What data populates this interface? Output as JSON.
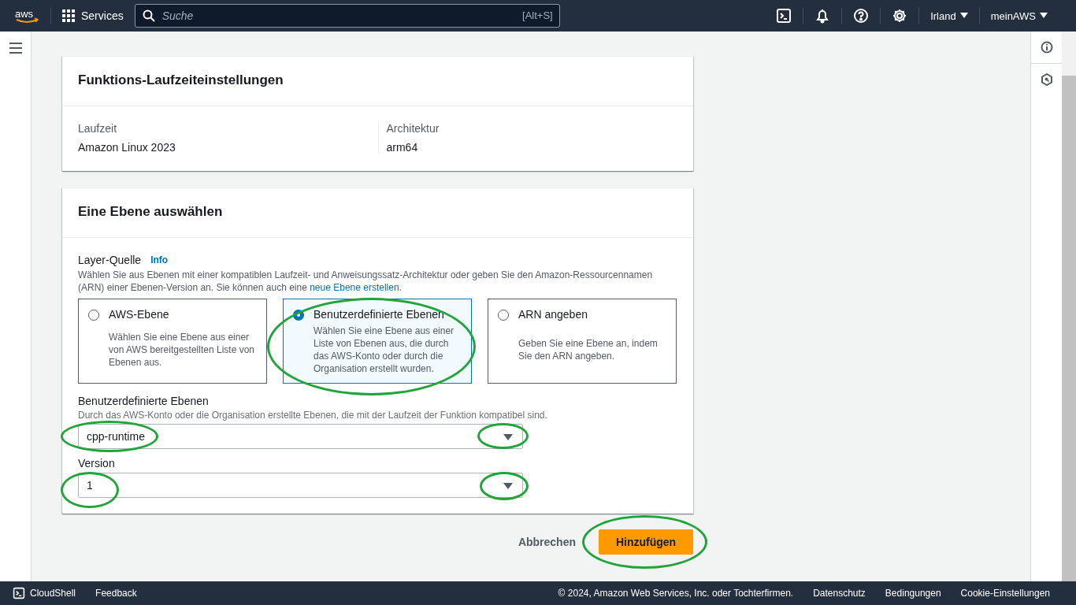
{
  "top_nav": {
    "logo": "aws",
    "services": "Services",
    "search": {
      "placeholder": "Suche",
      "shortcut": "[Alt+S]"
    },
    "region": "Irland",
    "account": "meinAWS"
  },
  "runtime_settings": {
    "title": "Funktions-Laufzeiteinstellungen",
    "fields": [
      {
        "label": "Laufzeit",
        "value": "Amazon Linux 2023"
      },
      {
        "label": "Architektur",
        "value": "arm64"
      }
    ]
  },
  "layer_selection": {
    "title": "Eine Ebene auswählen",
    "source": {
      "label": "Layer-Quelle",
      "info": "Info",
      "description": "Wählen Sie aus Ebenen mit einer kompatiblen Laufzeit- und Anweisungssatz-Architektur oder geben Sie den Amazon-Ressourcennamen (ARN) einer Ebenen-Version an. Sie können auch eine ",
      "link": "neue Ebene erstellen",
      "description_end": "."
    },
    "options": [
      {
        "title": "AWS-Ebene",
        "description": "Wählen Sie eine Ebene aus einer von AWS bereitgestellten Liste von Ebenen aus.",
        "selected": false,
        "highlighted": false
      },
      {
        "title": "Benutzerdefinierte Ebenen",
        "description": "Wählen Sie eine Ebene aus einer Liste von Ebenen aus, die durch das AWS-Konto oder durch die Organisation erstellt wurden.",
        "selected": true,
        "highlighted": true
      },
      {
        "title": "ARN angeben",
        "description": "Geben Sie eine Ebene an, indem Sie den ARN angeben.",
        "selected": false,
        "highlighted": false
      }
    ],
    "selects": [
      {
        "label": "Benutzerdefinierte Ebenen",
        "description": "Durch das AWS-Konto oder die Organisation erstellte Ebenen, die mit der Laufzeit der Funktion kompatibel sind.",
        "value": "cpp-runtime",
        "value_highlighted": true,
        "arrow_highlighted": true
      },
      {
        "label": "Version",
        "value": "1",
        "value_highlighted": true,
        "arrow_highlighted": true
      }
    ]
  },
  "actions": [
    {
      "label": "Abbrechen",
      "kind": "link",
      "highlighted": false
    },
    {
      "label": "Hinzufügen",
      "kind": "primary",
      "highlighted": true
    }
  ],
  "footer": {
    "cloudshell": "CloudShell",
    "feedback": "Feedback",
    "copyright": "© 2024, Amazon Web Services, Inc. oder Tochterfirmen.",
    "links": [
      "Datenschutz",
      "Bedingungen",
      "Cookie-Einstellungen"
    ]
  }
}
